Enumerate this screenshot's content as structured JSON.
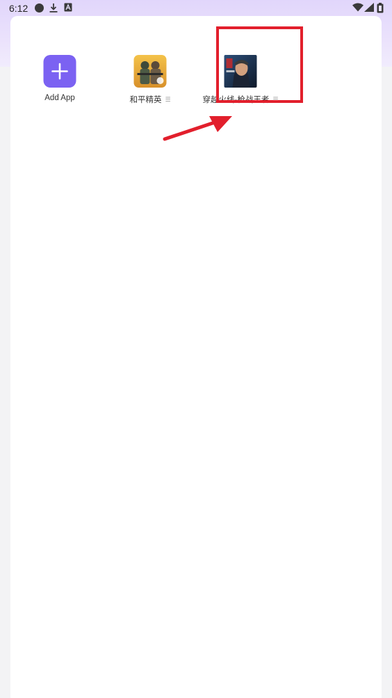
{
  "status_bar": {
    "time": "6:12",
    "icons": [
      "circle-notification-icon",
      "download-icon",
      "a-notification-icon",
      "wifi-icon",
      "signal-icon",
      "battery-icon"
    ]
  },
  "apps": [
    {
      "label": "Add App",
      "icon": "plus-icon",
      "has_menu": false
    },
    {
      "label": "和平精英",
      "icon": "pubg-game-icon",
      "has_menu": true,
      "menu_icon": "menu-dots-icon"
    },
    {
      "label": "穿越火线-枪战王者",
      "icon": "crossfire-game-icon",
      "has_menu": true,
      "menu_icon": "menu-dots-icon"
    }
  ],
  "annotation": {
    "box_color": "#e21f2c",
    "arrow_color": "#e21f2c"
  },
  "colors": {
    "accent": "#7b62f2",
    "header_gradient": "#e1d6fb"
  }
}
